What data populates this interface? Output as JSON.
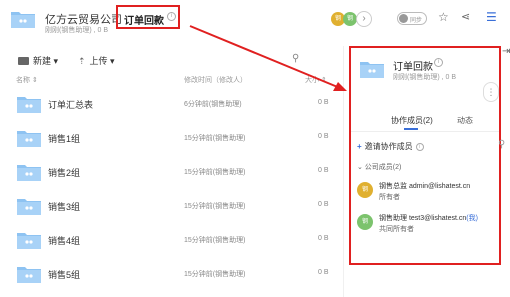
{
  "header": {
    "company": "亿方云贸易公司",
    "subline": "刚刚(钢售助理) , 0 B",
    "title": "订单回款",
    "avatar1": "钢",
    "avatar2": "钢",
    "sync_label": "同步"
  },
  "toolbar": {
    "new_label": "新建 ▾",
    "upload_label": "上传 ▾"
  },
  "columns": {
    "name": "名称 ⇕",
    "time": "修改时间（修改人）",
    "size": "大小 ⇕"
  },
  "files": [
    {
      "name": "订单汇总表",
      "time": "6分钟前(钢售助理)",
      "size": "0 B"
    },
    {
      "name": "销售1组",
      "time": "15分钟前(钢售助理)",
      "size": "0 B"
    },
    {
      "name": "销售2组",
      "time": "15分钟前(钢售助理)",
      "size": "0 B"
    },
    {
      "name": "销售3组",
      "time": "15分钟前(钢售助理)",
      "size": "0 B"
    },
    {
      "name": "销售4组",
      "time": "15分钟前(钢售助理)",
      "size": "0 B"
    },
    {
      "name": "销售5组",
      "time": "15分钟前(钢售助理)",
      "size": "0 B"
    }
  ],
  "panel": {
    "title": "订单回款",
    "sub": "刚刚(钢售助理) , 0 B",
    "tab_members": "协作成员(2)",
    "tab_activity": "动态",
    "invite": "邀请协作成员",
    "group": "⌄ 公司成员(2)",
    "members": [
      {
        "avatar": "钢",
        "line": "钢售总监 admin@lishatest.cn",
        "me": "",
        "role": "所有者",
        "color": "#e0b030"
      },
      {
        "avatar": "钢",
        "line": "钢售助理 test3@lishatest.cn",
        "me": "(我)",
        "role": "共同所有者",
        "color": "#7cc36d"
      }
    ]
  },
  "colors": {
    "accent": "#3a6fd8",
    "highlight": "#e02020",
    "folder": "#8ec3f2"
  }
}
